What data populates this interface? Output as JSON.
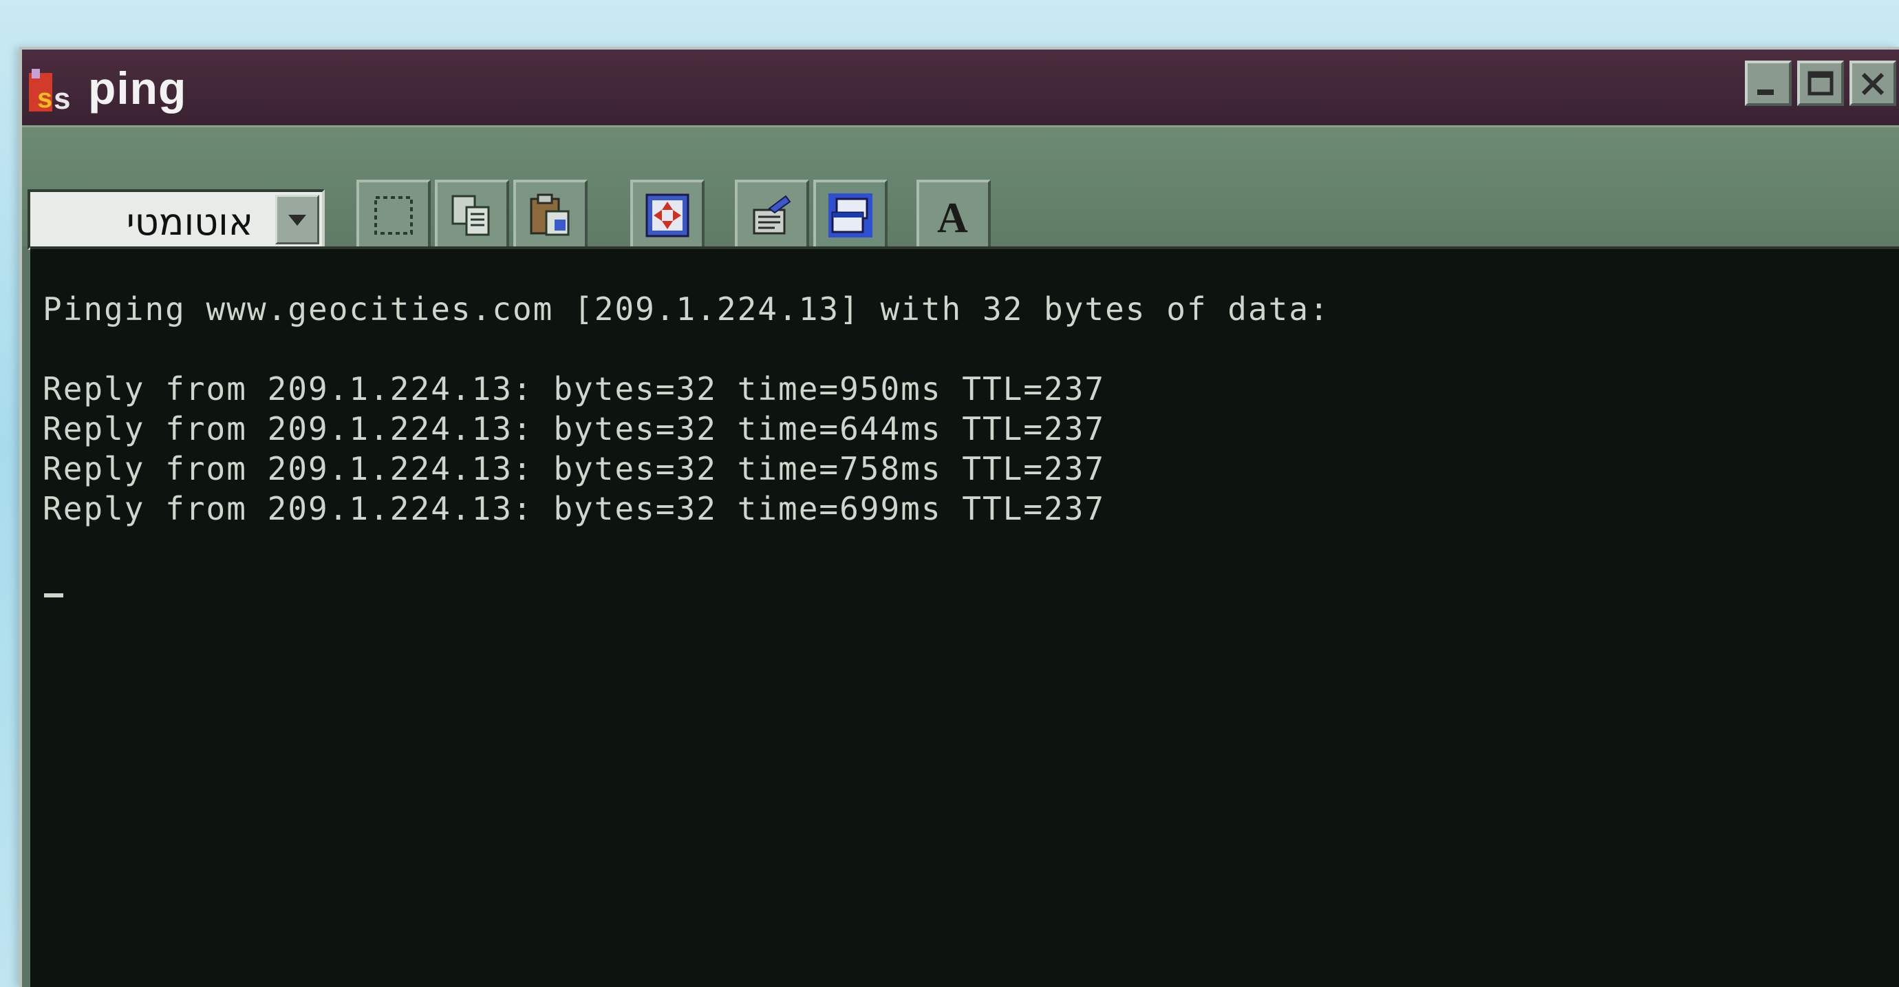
{
  "window": {
    "title": "ping",
    "icon": "ms-dos-icon",
    "controls": [
      "minimize-icon",
      "maximize-icon",
      "close-icon"
    ]
  },
  "toolbar": {
    "font_size_dropdown": {
      "value": "אוטומטי"
    },
    "buttons": [
      {
        "name": "mark-button",
        "icon": "mark-selection-icon"
      },
      {
        "name": "copy-button",
        "icon": "copy-icon"
      },
      {
        "name": "paste-button",
        "icon": "paste-icon"
      },
      {
        "name": "full-screen-button",
        "icon": "full-screen-icon"
      },
      {
        "name": "properties-button",
        "icon": "properties-icon"
      },
      {
        "name": "background-button",
        "icon": "background-icon"
      },
      {
        "name": "font-button",
        "icon": "font-icon",
        "label": "A"
      }
    ]
  },
  "console": {
    "lines": [
      "Pinging www.geocities.com [209.1.224.13] with 32 bytes of data:",
      "",
      "Reply from 209.1.224.13: bytes=32 time=950ms TTL=237",
      "Reply from 209.1.224.13: bytes=32 time=644ms TTL=237",
      "Reply from 209.1.224.13: bytes=32 time=758ms TTL=237",
      "Reply from 209.1.224.13: bytes=32 time=699ms TTL=237"
    ],
    "cursor": "_"
  },
  "colors": {
    "titlebar": "#3a2232",
    "toolbar": "#6d8a74",
    "console_bg": "#0d1410",
    "console_text": "#cfd6cc"
  }
}
